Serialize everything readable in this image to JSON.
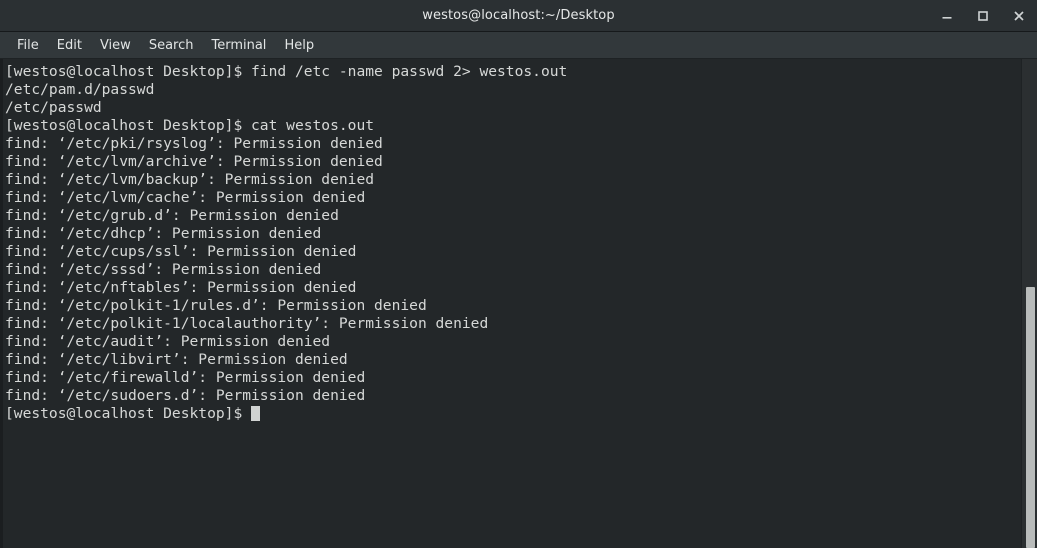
{
  "window": {
    "title": "westos@localhost:~/Desktop",
    "controls": [
      {
        "name": "minimize",
        "label": "_"
      },
      {
        "name": "maximize",
        "label": "□"
      },
      {
        "name": "close",
        "label": "×"
      }
    ]
  },
  "menubar": {
    "items": [
      {
        "label": "File"
      },
      {
        "label": "Edit"
      },
      {
        "label": "View"
      },
      {
        "label": "Search"
      },
      {
        "label": "Terminal"
      },
      {
        "label": "Help"
      }
    ]
  },
  "terminal": {
    "prompt": "[westos@localhost Desktop]$ ",
    "lines": [
      "[westos@localhost Desktop]$ find /etc -name passwd 2> westos.out",
      "/etc/pam.d/passwd",
      "/etc/passwd",
      "[westos@localhost Desktop]$ cat westos.out",
      "find: ‘/etc/pki/rsyslog’: Permission denied",
      "find: ‘/etc/lvm/archive’: Permission denied",
      "find: ‘/etc/lvm/backup’: Permission denied",
      "find: ‘/etc/lvm/cache’: Permission denied",
      "find: ‘/etc/grub.d’: Permission denied",
      "find: ‘/etc/dhcp’: Permission denied",
      "find: ‘/etc/cups/ssl’: Permission denied",
      "find: ‘/etc/sssd’: Permission denied",
      "find: ‘/etc/nftables’: Permission denied",
      "find: ‘/etc/polkit-1/rules.d’: Permission denied",
      "find: ‘/etc/polkit-1/localauthority’: Permission denied",
      "find: ‘/etc/audit’: Permission denied",
      "find: ‘/etc/libvirt’: Permission denied",
      "find: ‘/etc/firewalld’: Permission denied",
      "find: ‘/etc/sudoers.d’: Permission denied"
    ],
    "last_prompt": "[westos@localhost Desktop]$ "
  },
  "colors": {
    "titlebar_bg": "#2b3033",
    "menubar_bg": "#32383b",
    "terminal_bg": "#232729",
    "terminal_fg": "#d6d8d7",
    "scrollbar_track": "#2b2f31",
    "scrollbar_thumb": "#b9bcbb"
  }
}
